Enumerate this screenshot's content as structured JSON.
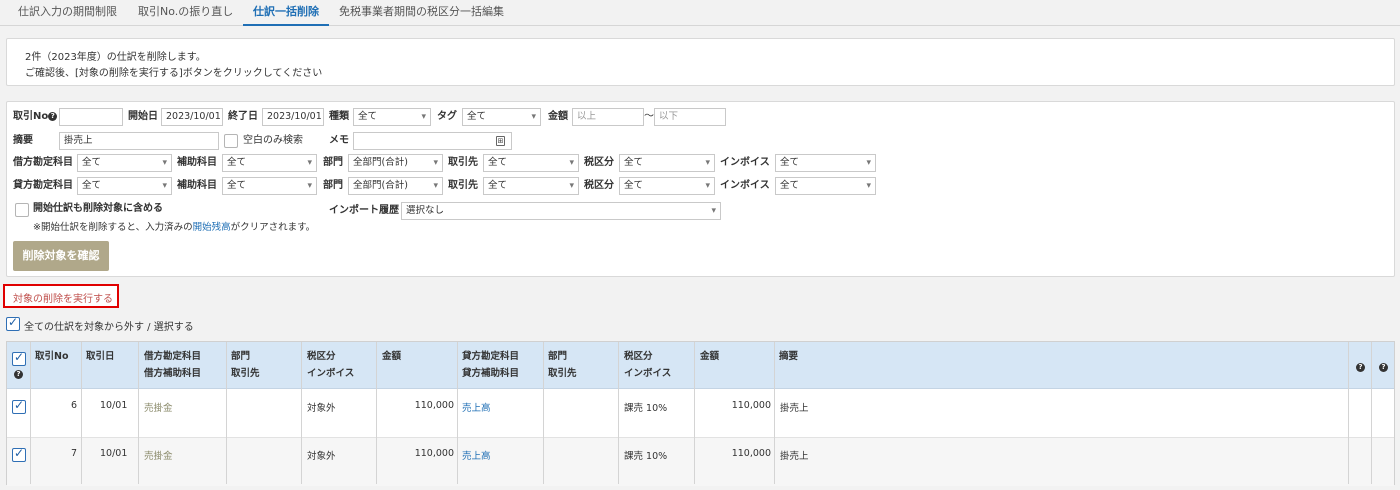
{
  "tabs": [
    {
      "label": "仕訳入力の期間制限"
    },
    {
      "label": "取引No.の振り直し"
    },
    {
      "label": "仕訳一括削除"
    },
    {
      "label": "免税事業者期間の税区分一括編集"
    }
  ],
  "notice": {
    "line1": "2件（2023年度）の仕訳を削除します。",
    "line2": "ご確認後、[対象の削除を実行する]ボタンをクリックしてください"
  },
  "filter": {
    "torihiki_no_label": "取引No",
    "torihiki_no_value": "",
    "start_date_label": "開始日",
    "start_date_value": "2023/10/01",
    "end_date_label": "終了日",
    "end_date_value": "2023/10/01",
    "kind_label": "種類",
    "kind_value": "全て",
    "tag_label": "タグ",
    "tag_value": "全て",
    "amount_label": "金額",
    "amount_min_placeholder": "以上",
    "amount_sep": "〜",
    "amount_max_placeholder": "以下",
    "tekiyo_label": "摘要",
    "tekiyo_value": "掛売上",
    "blank_only_label": "空白のみ検索",
    "memo_label": "メモ",
    "memo_value": "",
    "debit_label": "借方勘定科目",
    "credit_label": "貸方勘定科目",
    "sub_label": "補助科目",
    "dept_label": "部門",
    "partner_label": "取引先",
    "tax_label": "税区分",
    "invoice_label": "インボイス",
    "all": "全て",
    "dept_value": "全部門(合計)",
    "include_opening_label": "開始仕訳も削除対象に含める",
    "note_prefix": "※開始仕訳を削除すると、入力済みの",
    "note_link": "開始残高",
    "note_suffix": "がクリアされます。",
    "import_label": "インポート履歴",
    "import_value": "選択なし",
    "confirm_button": "削除対象を確認"
  },
  "execute_button": "対象の削除を実行する",
  "toggle_all_label": "全ての仕訳を対象から外す / 選択する",
  "table": {
    "headers": {
      "no": "取引No",
      "date": "取引日",
      "debit_acct": "借方勘定科目",
      "debit_sub": "借方補助科目",
      "dept1": "部門",
      "partner1": "取引先",
      "tax1": "税区分",
      "invoice1": "インボイス",
      "amount1": "金額",
      "credit_acct": "貸方勘定科目",
      "credit_sub": "貸方補助科目",
      "dept2": "部門",
      "partner2": "取引先",
      "tax2": "税区分",
      "invoice2": "インボイス",
      "amount2": "金額",
      "tekiyo": "摘要"
    },
    "rows": [
      {
        "checked": true,
        "no": "6",
        "date": "10/01",
        "debit_acct": "売掛金",
        "tax1": "対象外",
        "amount1": "110,000",
        "credit_acct": "売上高",
        "tax2": "課売 10%",
        "amount2": "110,000",
        "tekiyo": "掛売上"
      },
      {
        "checked": true,
        "no": "7",
        "date": "10/01",
        "debit_acct": "売掛金",
        "tax1": "対象外",
        "amount1": "110,000",
        "credit_acct": "売上高",
        "tax2": "課売 10%",
        "amount2": "110,000",
        "tekiyo": "掛売上"
      }
    ]
  },
  "colors": {
    "accent": "#1f6fb5",
    "danger": "#e00000",
    "header_bg": "#d6e6f5",
    "confirm_bg": "#b0a88a"
  }
}
